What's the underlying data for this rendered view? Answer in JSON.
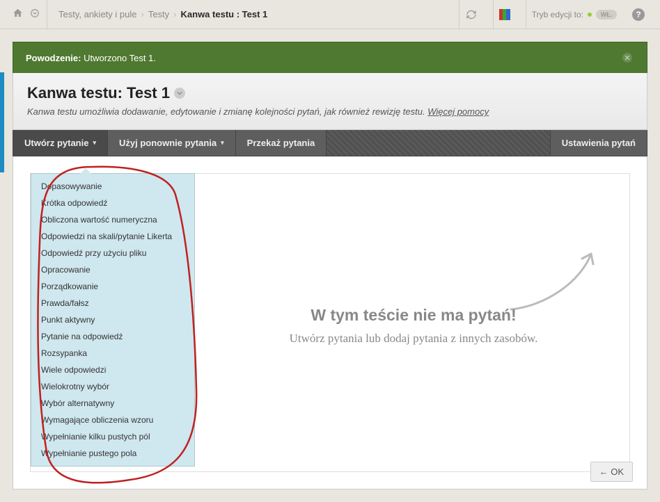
{
  "breadcrumbs": {
    "item1": "Testy, ankiety i pule",
    "item2": "Testy",
    "current": "Kanwa testu : Test 1"
  },
  "edit_mode": {
    "label": "Tryb edycji to:",
    "toggle": "WŁ."
  },
  "success": {
    "label": "Powodzenie:",
    "msg": "Utworzono Test 1."
  },
  "title": {
    "heading": "Kanwa testu: Test 1",
    "desc": "Kanwa testu umożliwia dodawanie, edytowanie i zmianę kolejności pytań, jak również rewizję testu.",
    "help": "Więcej pomocy"
  },
  "menubar": {
    "create": "Utwórz pytanie",
    "reuse": "Użyj ponownie pytania",
    "upload": "Przekaż pytania",
    "settings": "Ustawienia pytań"
  },
  "question_types": [
    "Dopasowywanie",
    "Krótka odpowiedź",
    "Obliczona wartość numeryczna",
    "Odpowiedzi na skali/pytanie Likerta",
    "Odpowiedź przy użyciu pliku",
    "Opracowanie",
    "Porządkowanie",
    "Prawda/fałsz",
    "Punkt aktywny",
    "Pytanie na odpowiedź",
    "Rozsypanka",
    "Wiele odpowiedzi",
    "Wielokrotny wybór",
    "Wybór alternatywny",
    "Wymagające obliczenia wzoru",
    "Wypełnianie kilku pustych pól",
    "Wypełnianie pustego pola"
  ],
  "empty": {
    "heading": "W tym teście nie ma pytań!",
    "sub": "Utwórz pytania lub dodaj pytania z innych zasobów."
  },
  "ok_button": "← OK"
}
